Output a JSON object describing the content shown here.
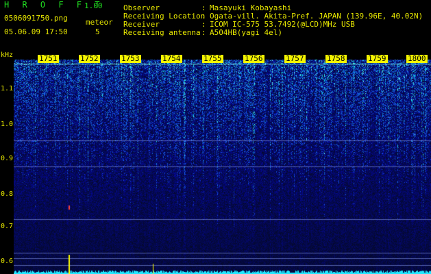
{
  "header": {
    "app_name": "H R O F F T",
    "version": "1.00",
    "file_name": "0506091750.png",
    "datetime": "05.06.09 17:50",
    "meteor_label": "meteor",
    "meteor_count": "5"
  },
  "info": [
    {
      "key": "Observer",
      "sep": ":",
      "value": "Masayuki Kobayashi"
    },
    {
      "key": "Receiving Location",
      "sep": ":",
      "value": "Ogata-vill. Akita-Pref. JAPAN (139.96E, 40.02N)"
    },
    {
      "key": "Receiver",
      "sep": ":",
      "value": "ICOM IC-575 53.7492(@LCD)MHz USB"
    },
    {
      "key": "Receiving antenna",
      "sep": ":",
      "value": "A504HB(yagi 4el)"
    }
  ],
  "axes": {
    "y_unit": "kHz",
    "y_ticks": [
      "1.1",
      "1.0",
      "0.9",
      "0.8",
      "0.7",
      "0.6"
    ],
    "time_ticks": [
      "1751",
      "1752",
      "1753",
      "1754",
      "1755",
      "1756",
      "1757",
      "1758",
      "1759",
      "1800"
    ]
  },
  "colors": {
    "text_yellow": "#e8e800",
    "title_green": "#21e021",
    "spectrogram_blue": "#0a1a8a",
    "signal_cyan": "#22e8ff"
  }
}
